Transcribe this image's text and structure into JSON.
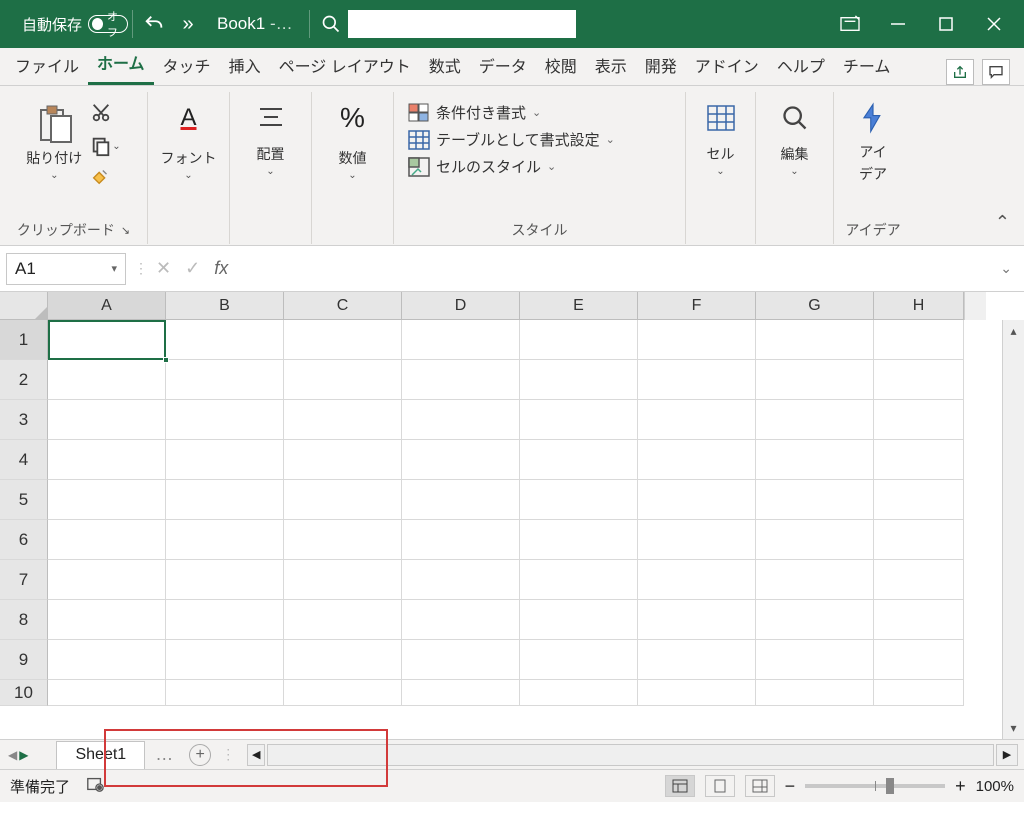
{
  "title": {
    "autosave": "自動保存",
    "autosave_toggle": "オフ",
    "doc": "Book1",
    "doc_suffix": "-…"
  },
  "tabs": {
    "file": "ファイル",
    "home": "ホーム",
    "touch": "タッチ",
    "insert": "挿入",
    "page": "ページ レイアウト",
    "formula": "数式",
    "data": "データ",
    "review": "校閲",
    "view": "表示",
    "dev": "開発",
    "addin": "アドイン",
    "help": "ヘルプ",
    "team": "チーム"
  },
  "ribbon": {
    "clipboard": {
      "paste": "貼り付け",
      "label": "クリップボード"
    },
    "font": {
      "btn": "フォント"
    },
    "align": {
      "btn": "配置"
    },
    "number": {
      "btn": "数値",
      "glyph": "%"
    },
    "styles": {
      "cond": "条件付き書式",
      "table": "テーブルとして書式設定",
      "cell": "セルのスタイル",
      "label": "スタイル"
    },
    "cells": {
      "btn": "セル"
    },
    "edit": {
      "btn": "編集"
    },
    "idea": {
      "btn1": "アイ",
      "btn2": "デア",
      "label": "アイデア"
    }
  },
  "formula_bar": {
    "name": "A1",
    "fx": "fx"
  },
  "columns": [
    "A",
    "B",
    "C",
    "D",
    "E",
    "F",
    "G",
    "H"
  ],
  "rows": [
    "1",
    "2",
    "3",
    "4",
    "5",
    "6",
    "7",
    "8",
    "9",
    "10"
  ],
  "sheet": {
    "tab": "Sheet1",
    "dots": "…"
  },
  "status": {
    "ready": "準備完了",
    "zoom": "100%",
    "minus": "−",
    "plus": "+"
  }
}
